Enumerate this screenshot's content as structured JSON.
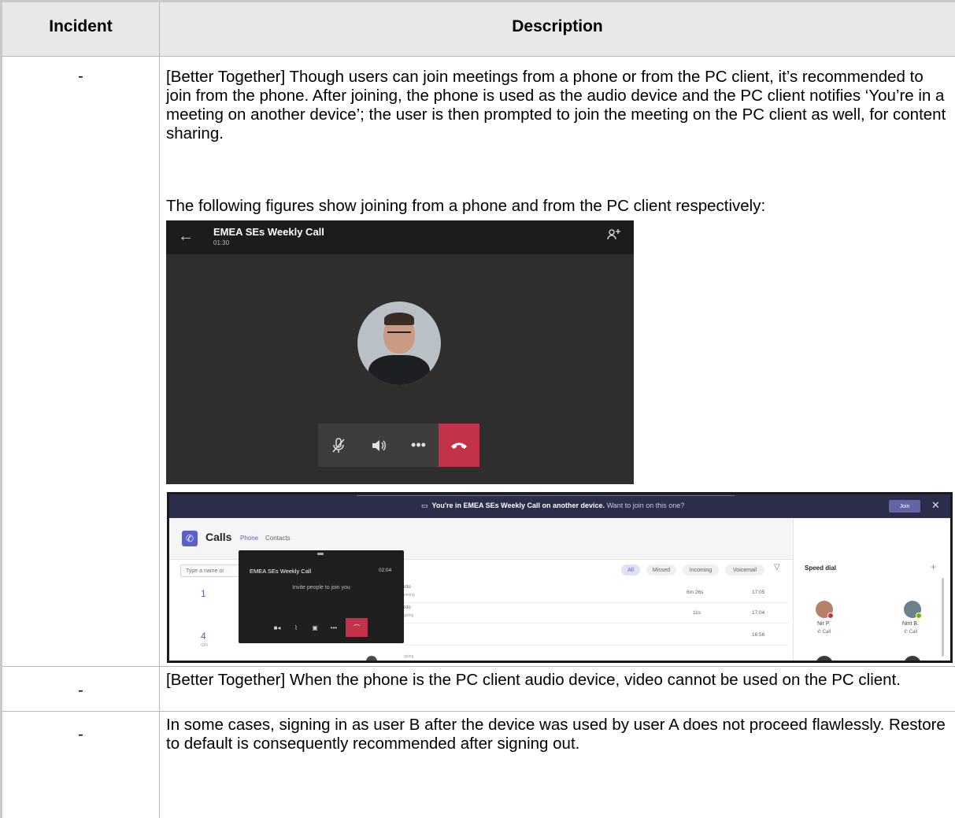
{
  "table": {
    "col_incident": "Incident",
    "col_description": "Description",
    "rows": [
      {
        "incident": "-",
        "paragraph1": "[Better Together] Though users can join meetings from a phone or from the PC client, it’s recommended to join from the phone. After joining, the phone is used as the audio device and the PC client notifies ‘You’re in a meeting on another device’; the user is then prompted to join the meeting on the PC client as well, for content sharing.",
        "paragraph2": "The following figures show joining from a phone and from the PC client respectively:"
      },
      {
        "incident": "-",
        "paragraph1": "[Better Together] When the phone is the PC client audio device, video cannot be used on the PC client."
      },
      {
        "incident": "-",
        "paragraph1": "In some cases, signing in as user B after the device was used by user A does not proceed flawlessly. Restore to default is consequently recommended after signing out."
      }
    ]
  },
  "phone_screenshot": {
    "back_icon": "arrow-left-icon",
    "meeting_title": "EMEA SEs Weekly Call",
    "timer": "01:30",
    "people_icon": "add-people-icon",
    "controls": [
      "mute-mic-icon",
      "speaker-icon",
      "more-icon",
      "hang-up-icon"
    ],
    "colors": {
      "background": "#2e2e2e",
      "hangup": "#c4314b"
    }
  },
  "pc_screenshot": {
    "banner_bold": "You're in EMEA SEs Weekly Call on another device.",
    "banner_light": "Want to join on this one?",
    "join_label": "Join",
    "app_title": "Calls",
    "tabs": [
      "Phone",
      "Contacts"
    ],
    "search_placeholder": "Type a name or",
    "dialpad": [
      {
        "num": "1",
        "sub": ""
      },
      {
        "num": "4",
        "sub": "GHI"
      }
    ],
    "mini_window": {
      "title": "EMEA SEs Weekly Call",
      "time": "02:04",
      "invite_text": "Invite people to join you"
    },
    "filters": [
      "All",
      "Missed",
      "Incoming",
      "Voicemail"
    ],
    "history": [
      {
        "name_frag": "rdo",
        "dir_frag": "oming",
        "duration": "6m 26s",
        "time": "17:05"
      },
      {
        "name_frag": "rdo",
        "dir_frag": "going",
        "duration": "11s",
        "time": "17:04"
      },
      {
        "name_frag": "",
        "dir_frag": "going",
        "duration": "",
        "time": "16:56"
      }
    ],
    "speed_dial": {
      "title": "Speed dial",
      "contacts": [
        {
          "name": "Nir P.",
          "action": "Call"
        },
        {
          "name": "Nirit B.",
          "action": "Call"
        }
      ]
    },
    "colors": {
      "banner": "#2b2d4a",
      "accent": "#5b5fc7",
      "hangup": "#c4314b"
    }
  }
}
